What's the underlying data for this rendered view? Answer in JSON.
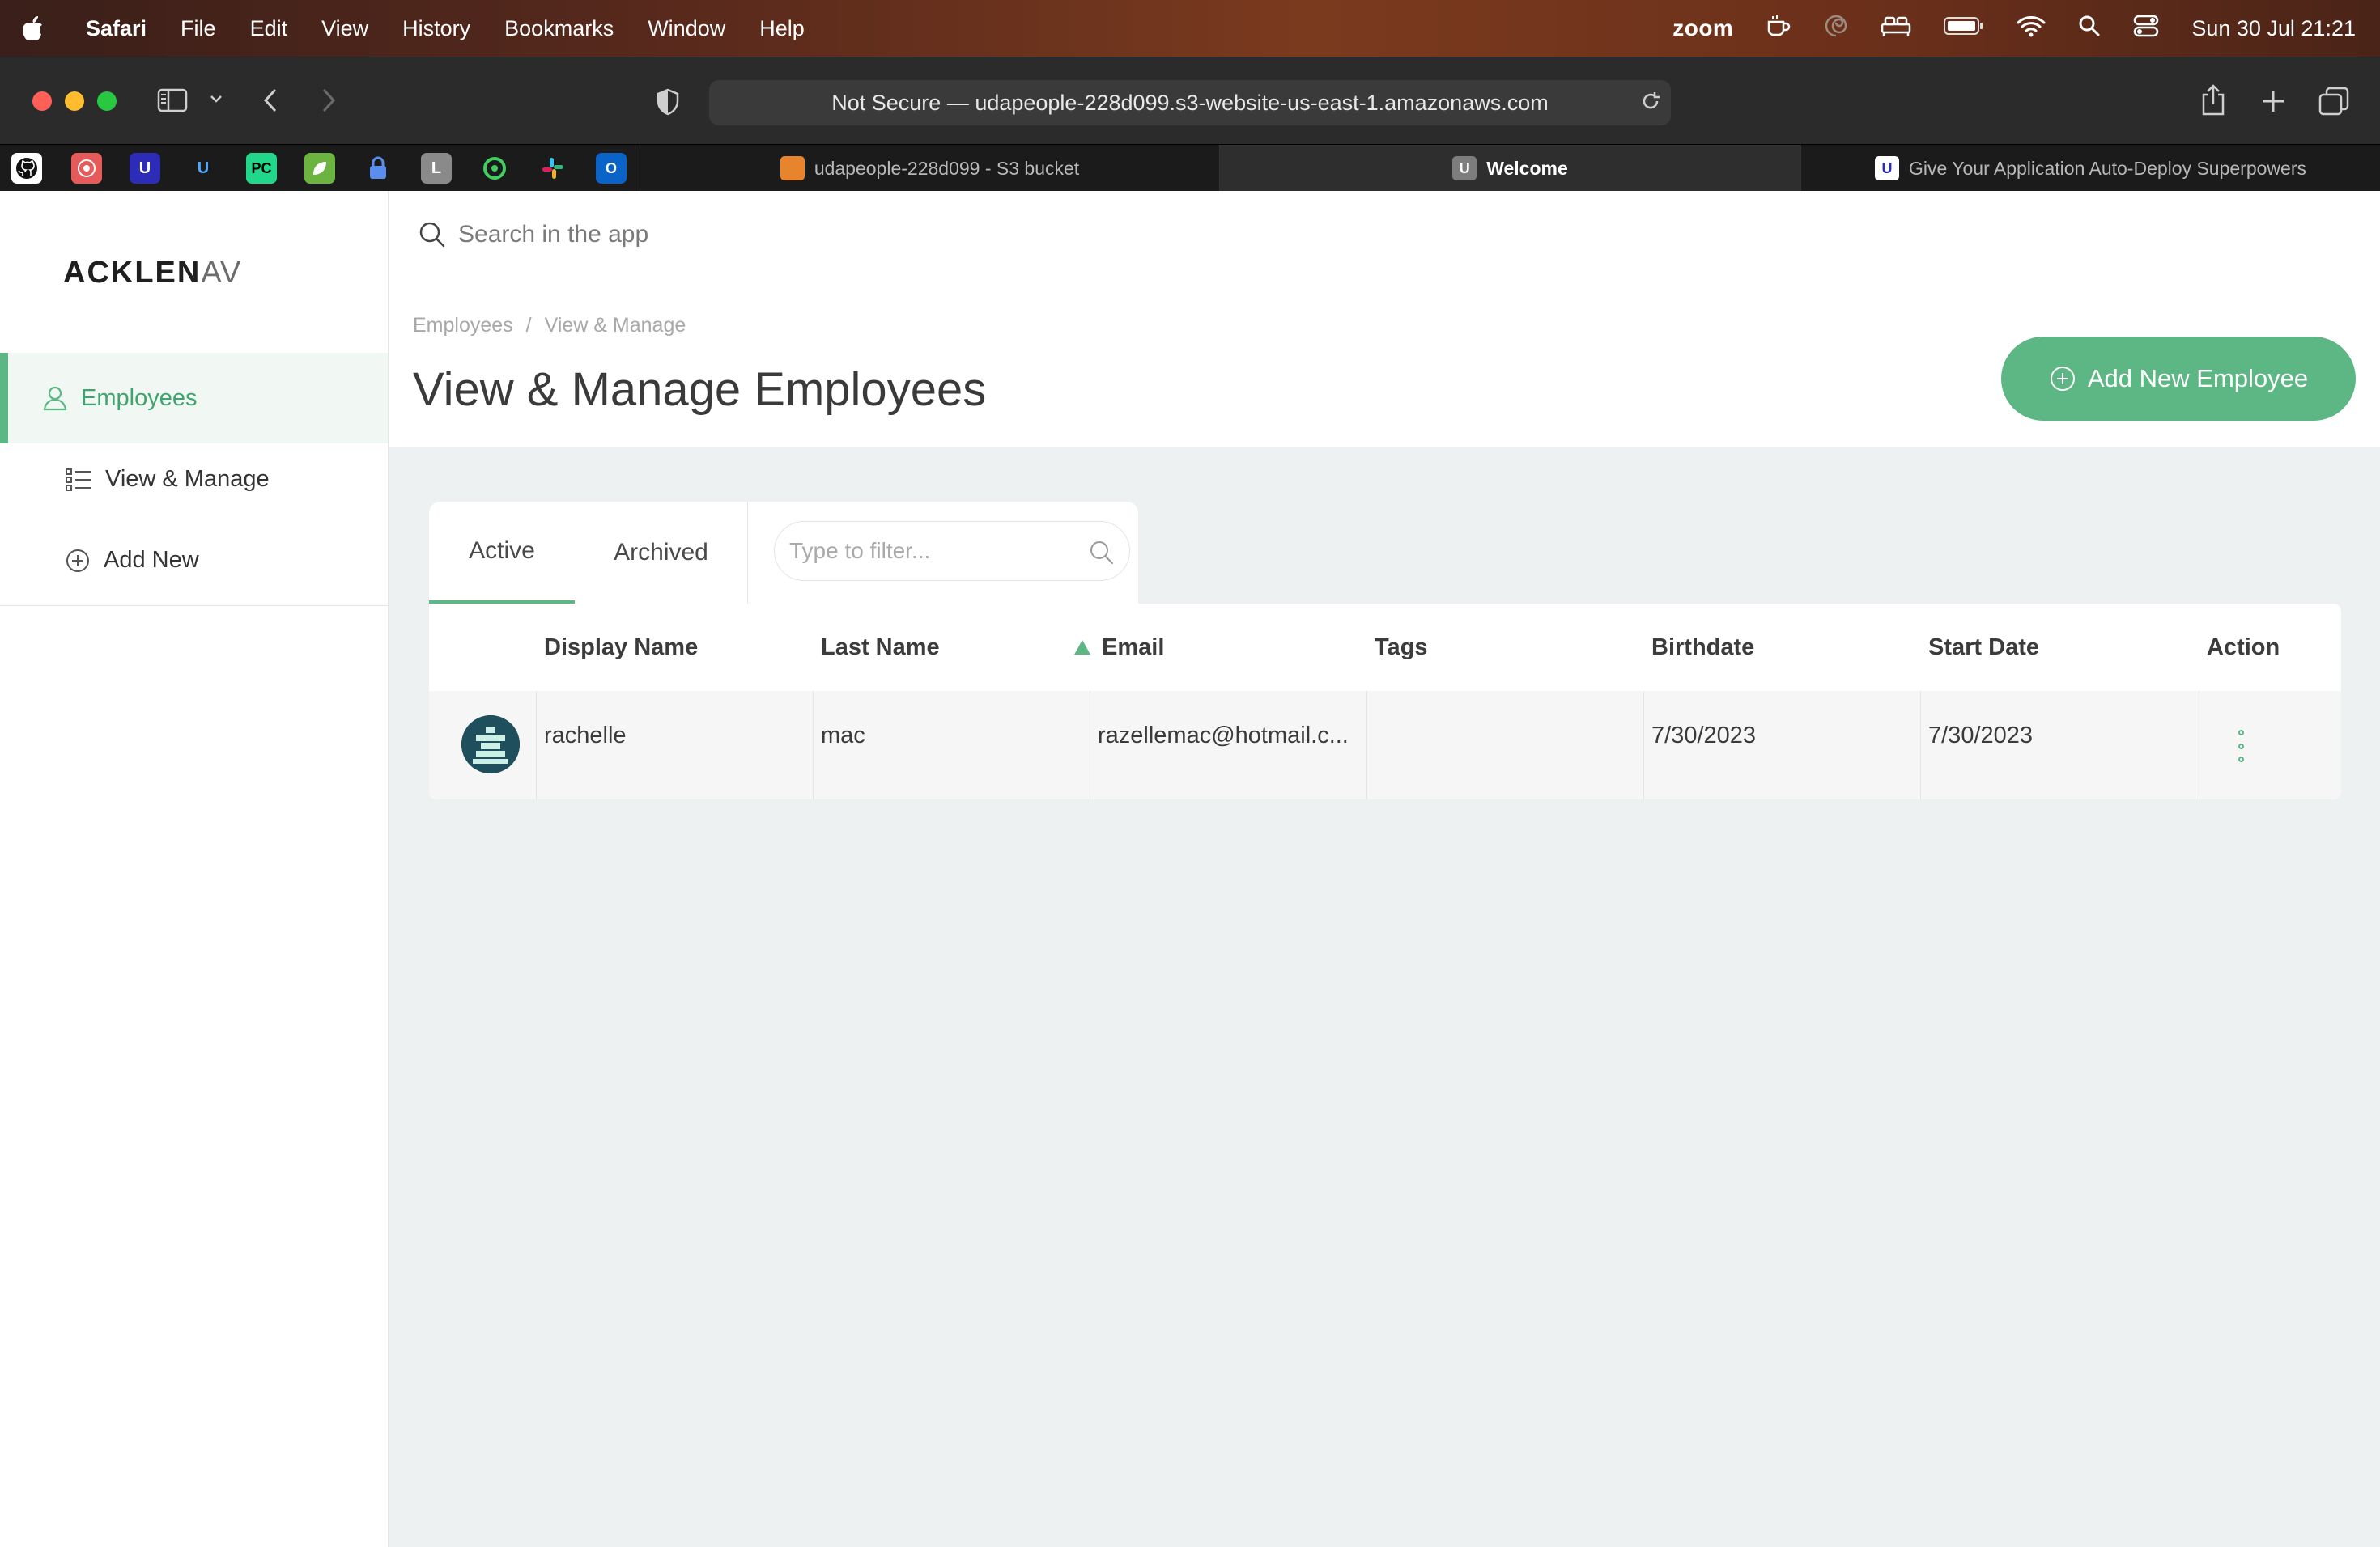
{
  "menubar": {
    "app": "Safari",
    "items": [
      "File",
      "Edit",
      "View",
      "History",
      "Bookmarks",
      "Window",
      "Help"
    ],
    "zoom": "zoom",
    "clock": "Sun 30 Jul  21:21"
  },
  "browser": {
    "url": "Not Secure — udapeople-228d099.s3-website-us-east-1.amazonaws.com",
    "tabs": [
      {
        "label": "udapeople-228d099 - S3 bucket"
      },
      {
        "label": "Welcome"
      },
      {
        "label": "Give Your Application Auto-Deploy Superpowers"
      }
    ],
    "favorites": [
      "github-icon",
      "app-icon",
      "udacity-icon",
      "udacity-icon",
      "pycharm-icon",
      "spring-icon",
      "lock-icon",
      "L",
      "circleci-icon",
      "slack-icon",
      "outlook-icon"
    ]
  },
  "sidebar": {
    "logo_main": "ACKLEN",
    "logo_tail": "AV",
    "section": "Employees",
    "items": [
      {
        "label": "View & Manage"
      },
      {
        "label": "Add New"
      }
    ]
  },
  "header": {
    "search_placeholder": "Search in the app",
    "breadcrumb": [
      "Employees",
      "View & Manage"
    ],
    "breadcrumb_sep": "/",
    "title": "View & Manage Employees",
    "add_button": "Add New Employee"
  },
  "filters": {
    "tabs": [
      "Active",
      "Archived"
    ],
    "active_tab": "Active",
    "filter_placeholder": "Type to filter..."
  },
  "table": {
    "columns": [
      "Display Name",
      "Last Name",
      "Email",
      "Tags",
      "Birthdate",
      "Start Date",
      "Action"
    ],
    "sorted_column": "Email",
    "rows": [
      {
        "display_name": "rachelle",
        "last_name": "mac",
        "email": "razellemac@hotmail.c...",
        "tags": "",
        "birthdate": "7/30/2023",
        "start_date": "7/30/2023"
      }
    ]
  },
  "colors": {
    "accent": "#5cb784",
    "sidebar_active_bg": "#f1f8f4",
    "main_bg": "#eef1f1"
  }
}
